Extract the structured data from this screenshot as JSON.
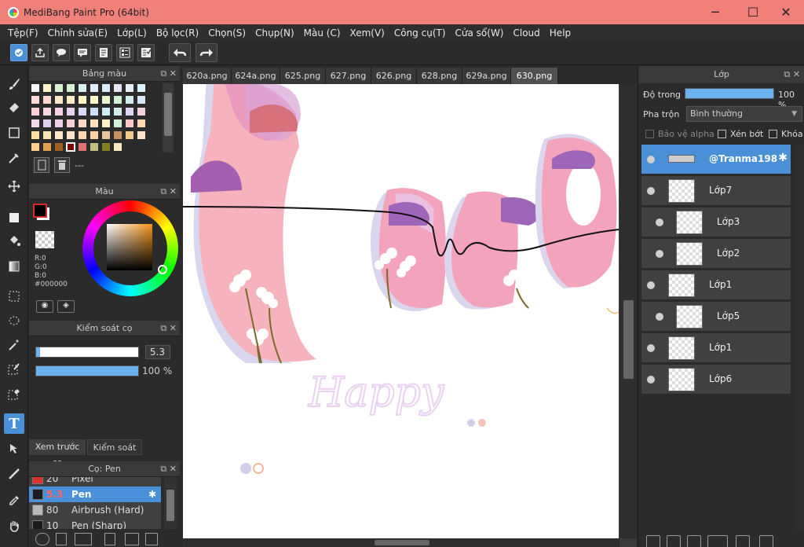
{
  "window": {
    "title": "MediBang Paint Pro (64bit)",
    "minimize_glyph": "─",
    "maximize_glyph": "☐",
    "close_glyph": "✕"
  },
  "menu": [
    "Tệp(F)",
    "Chỉnh sửa(E)",
    "Lớp(L)",
    "Bộ lọc(R)",
    "Chọn(S)",
    "Chụp(N)",
    "Màu (C)",
    "Xem(V)",
    "Công cụ(T)",
    "Cửa sổ(W)",
    "Cloud",
    "Help"
  ],
  "toolbar_icons": [
    "cloud-save-icon",
    "share-icon",
    "comment-icon",
    "document-icon",
    "layers-list-icon",
    "checklist-icon",
    "undo-icon",
    "redo-icon"
  ],
  "tools": [
    "brush-icon",
    "eraser-icon",
    "rectangle-icon",
    "pen-stroke-icon",
    "move-icon",
    "fill-rectangle-icon",
    "bucket-icon",
    "gradient-icon",
    "rect-select-icon",
    "lasso-icon",
    "magic-wand-icon",
    "select-pen-icon",
    "select-eraser-icon",
    "text-icon",
    "divide-icon",
    "eyedropper-brush-icon",
    "eyedropper-icon",
    "hand-icon"
  ],
  "text_tool_glyph": "T",
  "palette_panel": {
    "title": "Bảng màu",
    "add_button": "+",
    "none_label": "---",
    "colors": [
      "#f6f6f6",
      "#fff3c8",
      "#d6f0d2",
      "#d6f0d2",
      "#d7eeee",
      "#e0ecf7",
      "#d9ecf9",
      "#e8e4f3",
      "#e4f0f6",
      "#d9f1f7",
      "#ffd8d8",
      "#fcd8d0",
      "#ffe8c8",
      "#ffeec8",
      "#fff4c0",
      "#fff8c8",
      "#e8f6d0",
      "#d4f0d6",
      "#d0ecec",
      "#d8e6f8",
      "#ffd0d8",
      "#f8d8e4",
      "#f8d0e4",
      "#e8d0f0",
      "#d8d8f8",
      "#cce0f8",
      "#d0ecf8",
      "#d0ecec",
      "#ddd6f2",
      "#f2d0e0",
      "#f3d8e8",
      "#ddd0f0",
      "#f0d0e8",
      "#f8d0d8",
      "#ffd8c8",
      "#ffe0c0",
      "#fff0c8",
      "#d0f0d8",
      "#ffc8c8",
      "#ffd8b0",
      "#ffe0a0",
      "#f8e6b0",
      "#ffe8c8",
      "#ffe4c8",
      "#ffd8b0",
      "#ffd0a8",
      "#e8c8a0",
      "#c89060",
      "#f0c890",
      "#ffe0c8",
      "#ffd090",
      "#e0a050",
      "#a06020",
      "#800000",
      "#e07070",
      "#c0c080",
      "#808020",
      "#f8e8c0"
    ]
  },
  "color_panel": {
    "title": "Màu",
    "foreground": "#000000",
    "background": "#ffffff",
    "r": "R:0",
    "g": "G:0",
    "b": "B:0",
    "hex": "#000000"
  },
  "brush_control": {
    "title": "Kiểm soát cọ",
    "size_value": "5.3",
    "size_fraction": 0.04,
    "opacity_value": "100 %",
    "opacity_fraction": 1.0
  },
  "subtabs": [
    "Xem trước cọ",
    "Kiểm soát cọ"
  ],
  "brush_panel": {
    "title": "Cọ: Pen",
    "brushes": [
      {
        "size": "20",
        "name": "Pixel",
        "color": "#e0302a"
      },
      {
        "size": "5.3",
        "name": "Pen",
        "color": "#1b1b1b",
        "selected": true
      },
      {
        "size": "80",
        "name": "Airbrush (Hard)",
        "color": "#b8b8b8"
      },
      {
        "size": "10",
        "name": "Pen (Sharp)",
        "color": "#1b1b1b"
      }
    ]
  },
  "tabs": [
    "620a.png",
    "624a.png",
    "625.png",
    "627.png",
    "626.png",
    "628.png",
    "629a.png",
    "630.png"
  ],
  "active_tab": 7,
  "canvas_text": "Happy",
  "layer_panel": {
    "title": "Lớp",
    "opacity_label": "Độ trong",
    "opacity_value": "100 %",
    "opacity_fraction": 1.0,
    "blend_label": "Pha trộn",
    "blend_value": "Bình thường",
    "protect_alpha": "Bảo vệ alpha",
    "clipping": "Xén bớt",
    "lock": "Khóa",
    "layers": [
      {
        "name": "@Tranma198",
        "selected": true,
        "indent": false
      },
      {
        "name": "Lớp7",
        "selected": false,
        "indent": false
      },
      {
        "name": "Lớp3",
        "selected": false,
        "indent": true
      },
      {
        "name": "Lớp2",
        "selected": false,
        "indent": true
      },
      {
        "name": "Lớp1",
        "selected": false,
        "indent": false
      },
      {
        "name": "Lớp5",
        "selected": false,
        "indent": true
      },
      {
        "name": "Lớp1",
        "selected": false,
        "indent": false
      },
      {
        "name": "Lớp6",
        "selected": false,
        "indent": false
      }
    ]
  },
  "accent": "#4a90d9",
  "titlebar_color": "#f2807a"
}
